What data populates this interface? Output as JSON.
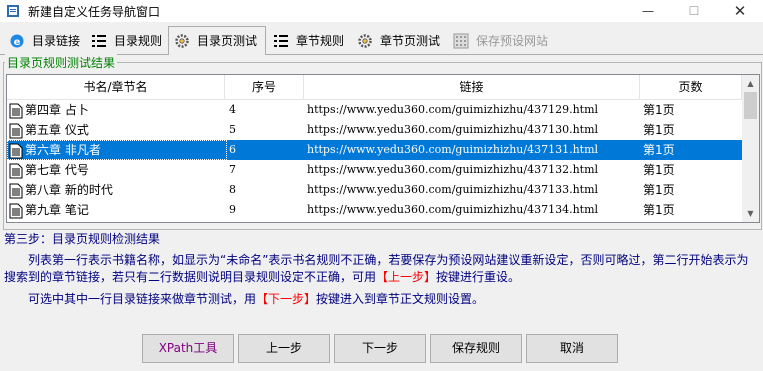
{
  "window": {
    "title": "新建自定义任务导航窗口",
    "minimize": "—",
    "maximize": "☐",
    "close": "✕"
  },
  "tabs": [
    {
      "label": "目录链接",
      "icon": "ie-icon",
      "state": "normal"
    },
    {
      "label": "目录规则",
      "icon": "list-icon",
      "state": "normal"
    },
    {
      "label": "目录页测试",
      "icon": "gear-icon",
      "state": "active"
    },
    {
      "label": "章节规则",
      "icon": "list-icon",
      "state": "normal"
    },
    {
      "label": "章节页测试",
      "icon": "gear-icon",
      "state": "normal"
    },
    {
      "label": "保存预设网站",
      "icon": "grid-icon",
      "state": "disabled"
    }
  ],
  "group": {
    "title": "目录页规则测试结果",
    "title_color": "#008000"
  },
  "table": {
    "columns": [
      "书名/章节名",
      "序号",
      "链接",
      "页数"
    ],
    "rows": [
      {
        "name": "第四章 占卜",
        "seq": "4",
        "link": "https://www.yedu360.com/guimizhizhu/437129.html",
        "pages": "第1页",
        "selected": false
      },
      {
        "name": "第五章 仪式",
        "seq": "5",
        "link": "https://www.yedu360.com/guimizhizhu/437130.html",
        "pages": "第1页",
        "selected": false
      },
      {
        "name": "第六章 非凡者",
        "seq": "6",
        "link": "https://www.yedu360.com/guimizhizhu/437131.html",
        "pages": "第1页",
        "selected": true
      },
      {
        "name": "第七章 代号",
        "seq": "7",
        "link": "https://www.yedu360.com/guimizhizhu/437132.html",
        "pages": "第1页",
        "selected": false
      },
      {
        "name": "第八章 新的时代",
        "seq": "8",
        "link": "https://www.yedu360.com/guimizhizhu/437133.html",
        "pages": "第1页",
        "selected": false
      },
      {
        "name": "第九章 笔记",
        "seq": "9",
        "link": "https://www.yedu360.com/guimizhizhu/437134.html",
        "pages": "第1页",
        "selected": false
      }
    ],
    "selection_color": "#0078d7"
  },
  "info": {
    "step_title": "第三步：目录页规则检测结果",
    "para1_a": "列表第一行表示书籍名称，如显示为“未命名”表示书名规则不正确，若要保存为预设网站建议重新设定，否则可略过，第二行开始表示为搜索到的章节链接，若只有二行数据则说明目录规则设定不正确，可用",
    "para1_red": "【上一步】",
    "para1_b": "按键进行重设。",
    "para2_a": "可选中其中一行目录链接来做章节测试，用",
    "para2_red": "【下一步】",
    "para2_b": "按键进入到章节正文规则设置。",
    "text_color": "#000080",
    "highlight_color": "#ff0000"
  },
  "buttons": {
    "xpath": "XPath工具",
    "prev": "上一步",
    "next": "下一步",
    "save": "保存规则",
    "cancel": "取消"
  }
}
